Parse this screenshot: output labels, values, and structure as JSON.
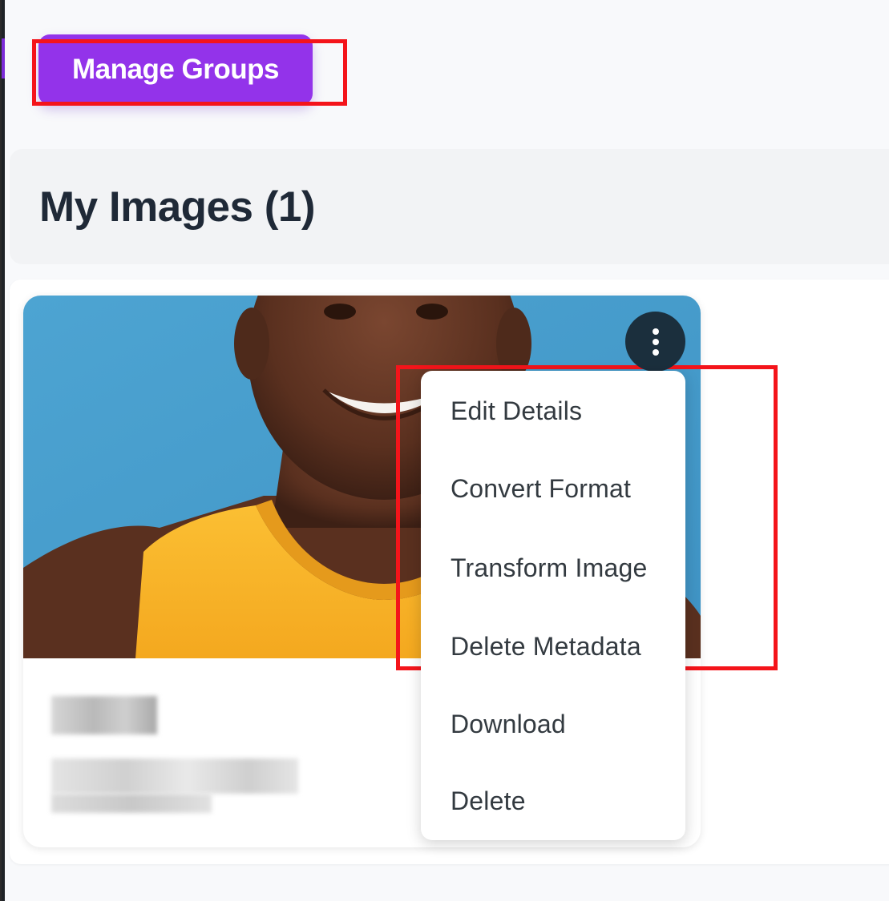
{
  "toolbar": {
    "manage_groups_label": "Manage Groups"
  },
  "section": {
    "title": "My Images (1)"
  },
  "card": {
    "image_subject": "portrait photo of a person in a yellow jersey on a blue background",
    "menu_icon": "kebab-vertical-icon"
  },
  "menu": {
    "items": [
      "Edit Details",
      "Convert Format",
      "Transform Image",
      "Delete Metadata",
      "Download",
      "Delete"
    ]
  },
  "colors": {
    "accent": "#9333ea",
    "highlight": "#f4141a",
    "menu_toggle_bg": "#1b2f3d",
    "photo_background": "#4aa0cd",
    "jersey": "#f9b52c"
  }
}
